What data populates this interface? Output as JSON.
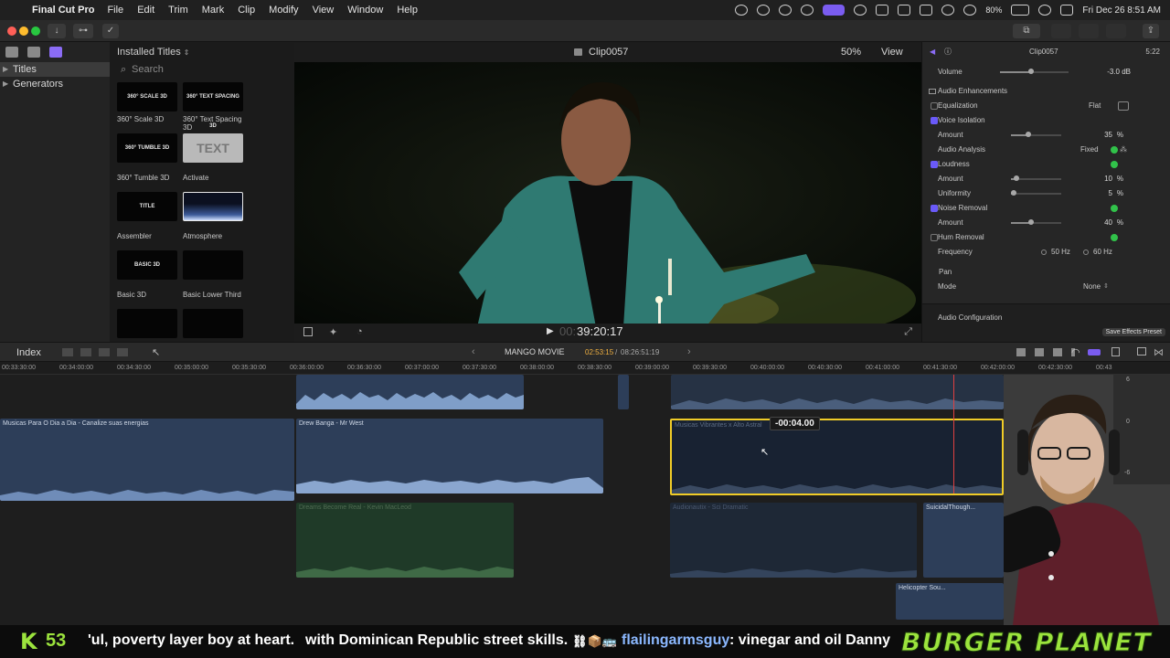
{
  "menubar": {
    "app_name": "Final Cut Pro",
    "menus": [
      "File",
      "Edit",
      "Trim",
      "Mark",
      "Clip",
      "Modify",
      "View",
      "Window",
      "Help"
    ],
    "battery": "80%",
    "datetime": "Fri Dec 26  8:51 AM"
  },
  "browser": {
    "sidebar": [
      {
        "label": "Titles",
        "selected": true
      },
      {
        "label": "Generators",
        "selected": false
      }
    ],
    "header": "Installed Titles",
    "search_placeholder": "Search",
    "titles": [
      {
        "thumb": "360° SCALE 3D",
        "label": "360° Scale 3D"
      },
      {
        "thumb": "360° TEXT SPACING 3D",
        "label": "360° Text Spacing 3D"
      },
      {
        "thumb": "360° TUMBLE 3D",
        "label": "360° Tumble 3D"
      },
      {
        "thumb": "TEXT",
        "label": "Activate"
      },
      {
        "thumb": "TITLE",
        "label": "Assembler"
      },
      {
        "thumb": "",
        "label": "Atmosphere"
      },
      {
        "thumb": "BASIC 3D",
        "label": "Basic 3D"
      },
      {
        "thumb": "",
        "label": "Basic Lower Third"
      },
      {
        "thumb": "",
        "label": ""
      },
      {
        "thumb": "",
        "label": ""
      }
    ]
  },
  "viewer": {
    "clip_name": "Clip0057",
    "zoom": "50%",
    "view_label": "View",
    "timecode_dim": "00:",
    "timecode": "39:20:17"
  },
  "inspector": {
    "clip_name": "Clip0057",
    "duration": "5:22",
    "volume_label": "Volume",
    "volume_value": "-3.0",
    "volume_unit": "dB",
    "section": "Audio Enhancements",
    "equalization": {
      "label": "Equalization",
      "value": "Flat"
    },
    "voice_isolation": {
      "label": "Voice Isolation",
      "amount_label": "Amount",
      "amount": "35",
      "unit": "%"
    },
    "audio_analysis": {
      "label": "Audio Analysis",
      "value": "Fixed"
    },
    "loudness": {
      "label": "Loudness",
      "amount_label": "Amount",
      "amount": "10",
      "uniformity_label": "Uniformity",
      "uniformity": "5",
      "unit": "%"
    },
    "noise_removal": {
      "label": "Noise Removal",
      "amount_label": "Amount",
      "amount": "40",
      "unit": "%"
    },
    "hum_removal": {
      "label": "Hum Removal",
      "frequency_label": "Frequency",
      "opt1": "50 Hz",
      "opt2": "60 Hz"
    },
    "pan": {
      "label": "Pan",
      "mode_label": "Mode",
      "mode_value": "None"
    },
    "audio_configuration": "Audio Configuration",
    "save_preset": "Save Effects Preset",
    "volume_level": 0.45,
    "voice_level": 0.35,
    "loudness_level": 0.1,
    "uniformity_level": 0.05,
    "noise_level": 0.4
  },
  "timeline": {
    "index_label": "Index",
    "project_name": "MANGO MOVIE",
    "position": "02:53:15",
    "duration": "08:26:51:19",
    "ruler": [
      "00:33:30:00",
      "00:34:00:00",
      "00:34:30:00",
      "00:35:00:00",
      "00:35:30:00",
      "00:36:00:00",
      "00:36:30:00",
      "00:37:00:00",
      "00:37:30:00",
      "00:38:00:00",
      "00:38:30:00",
      "00:39:00:00",
      "00:39:30:00",
      "00:40:00:00",
      "00:40:30:00",
      "00:41:00:00",
      "00:41:30:00",
      "00:42:00:00",
      "00:42:30:00",
      "00:43"
    ],
    "clips": {
      "a": "Musicas Para O Dia a Dia - Canalize suas energias",
      "b": "Drew Banga - Mr West",
      "c": "Musicas Vibrantes x Alto Astral",
      "d": "Dreams Become Real - Kevin MacLeod",
      "e": "Audionautix - Sci Dramatic",
      "f": "SuicidalThough...",
      "g": "Helicopter Sou..."
    },
    "trim_popup": "-00:04.00",
    "meter_marks": [
      "6",
      "0",
      "-6"
    ]
  },
  "ticker": {
    "k_label": "K",
    "count": "53",
    "text1": "'ul, poverty layer boy at heart.",
    "text2": "with Dominican Republic street skills.",
    "emoji": "⛓📦🚌",
    "user": "flailingarmsguy",
    "text3": ": vinegar and oil Danny",
    "brand": "BURGER PLANET"
  },
  "colors": {
    "accent": "#7a5cf0",
    "playhead": "#e04040",
    "selection": "#f0cc27",
    "enabled_check": "#31c24a",
    "brand_green": "#9be33d"
  }
}
